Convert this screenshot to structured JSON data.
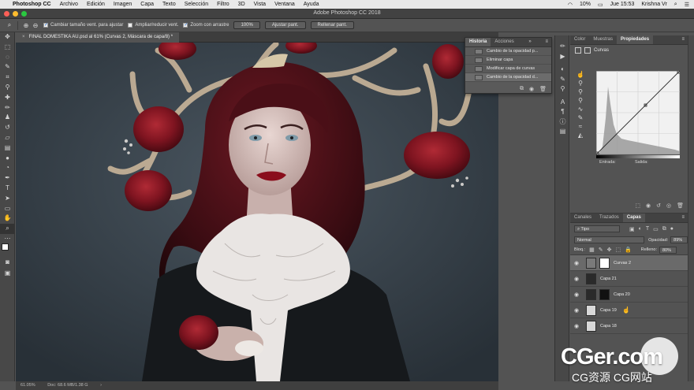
{
  "menubar": {
    "app": "Photoshop CC",
    "items": [
      "Archivo",
      "Edición",
      "Imagen",
      "Capa",
      "Texto",
      "Selección",
      "Filtro",
      "3D",
      "Vista",
      "Ventana",
      "Ayuda"
    ],
    "battery": "10%",
    "clock": "Jue 15:53",
    "user": "Krishna Vr"
  },
  "window": {
    "title": "Adobe Photoshop CC 2018"
  },
  "options": {
    "resize_windows": "Cambiar tamaño vent. para ajustar",
    "zoom_all": "Ampliar/reducir vent.",
    "scrubby_zoom": "Zoom con arrastre",
    "zoom_value": "100%",
    "fit_button": "Ajustar pant.",
    "fill_button": "Rellenar pant."
  },
  "document": {
    "tab": "FINAL DOMESTIKA AU.psd al 61% (Curvas 2, Máscara de capa/8) *",
    "status_zoom": "61.05%",
    "status_doc": "Doc: 68.6 MB/1.38 G"
  },
  "history": {
    "tabs": [
      "Historia",
      "Acciones"
    ],
    "active_tab": "Historia",
    "items": [
      "Cambio de la opacidad p...",
      "Eliminar capa",
      "Modificar capa de curvas",
      "Cambio de la opacidad d..."
    ]
  },
  "properties": {
    "tabs": [
      "Color",
      "Muestras",
      "Propiedades"
    ],
    "active_tab": "Propiedades",
    "header": "Curvas",
    "input_label": "Entrada:",
    "output_label": "Salida:"
  },
  "layers": {
    "tabs": [
      "Canales",
      "Trazados",
      "Capas"
    ],
    "active_tab": "Capas",
    "filter": "Tipo",
    "blend_mode": "Normal",
    "opacity_label": "Opacidad:",
    "opacity_value": "89%",
    "lock_label": "Bloq.:",
    "fill_label": "Relleno:",
    "fill_value": "80%",
    "items": [
      {
        "name": "Curvas 2",
        "selected": true
      },
      {
        "name": "Capa 21",
        "selected": false
      },
      {
        "name": "Capa 20",
        "selected": false
      },
      {
        "name": "Capa 19",
        "selected": false
      },
      {
        "name": "Capa 18",
        "selected": false
      }
    ]
  },
  "watermark": {
    "big": "CGer.com",
    "small": "CG资源 CG网站"
  },
  "colors": {
    "panel": "#535353",
    "dark": "#424242",
    "accent_rose": "#7e1420"
  }
}
